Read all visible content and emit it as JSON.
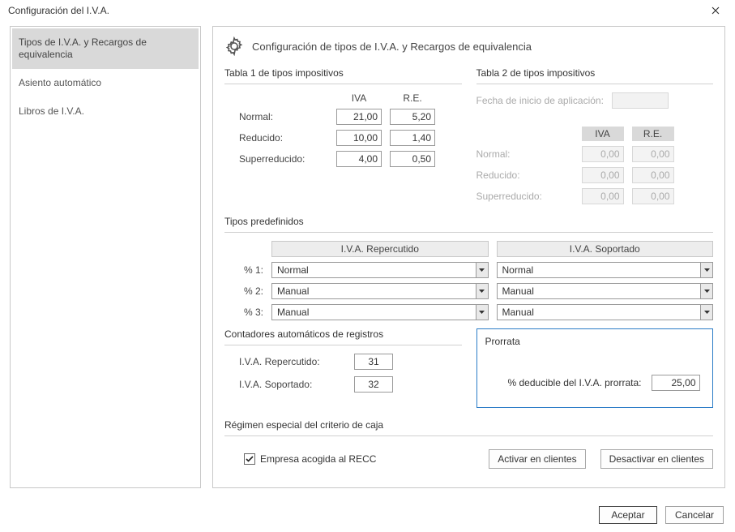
{
  "window": {
    "title": "Configuración del I.V.A."
  },
  "sidebar": {
    "items": [
      {
        "label": "Tipos de I.V.A. y Recargos de equivalencia"
      },
      {
        "label": "Asiento automático"
      },
      {
        "label": "Libros de I.V.A."
      }
    ]
  },
  "heading": "Configuración de tipos de I.V.A. y Recargos de equivalencia",
  "tabla1": {
    "title": "Tabla 1 de tipos impositivos",
    "col_iva": "IVA",
    "col_re": "R.E.",
    "rows": [
      {
        "label": "Normal:",
        "iva": "21,00",
        "re": "5,20"
      },
      {
        "label": "Reducido:",
        "iva": "10,00",
        "re": "1,40"
      },
      {
        "label": "Superreducido:",
        "iva": "4,00",
        "re": "0,50"
      }
    ]
  },
  "tabla2": {
    "title": "Tabla 2 de tipos impositivos",
    "fecha_label": "Fecha de inicio de aplicación:",
    "col_iva": "IVA",
    "col_re": "R.E.",
    "rows": [
      {
        "label": "Normal:",
        "iva": "0,00",
        "re": "0,00"
      },
      {
        "label": "Reducido:",
        "iva": "0,00",
        "re": "0,00"
      },
      {
        "label": "Superreducido:",
        "iva": "0,00",
        "re": "0,00"
      }
    ]
  },
  "predef": {
    "title": "Tipos predefinidos",
    "col_rep": "I.V.A. Repercutido",
    "col_sop": "I.V.A. Soportado",
    "rows": [
      {
        "label": "% 1:",
        "rep": "Normal",
        "sop": "Normal"
      },
      {
        "label": "% 2:",
        "rep": "Manual",
        "sop": "Manual"
      },
      {
        "label": "% 3:",
        "rep": "Manual",
        "sop": "Manual"
      }
    ]
  },
  "counters": {
    "title": "Contadores automáticos de registros",
    "rep_label": "I.V.A. Repercutido:",
    "rep_value": "31",
    "sop_label": "I.V.A. Soportado:",
    "sop_value": "32"
  },
  "prorrata": {
    "title": "Prorrata",
    "label": "% deducible del I.V.A. prorrata:",
    "value": "25,00"
  },
  "recc": {
    "title": "Régimen especial del criterio de caja",
    "check_label": "Empresa acogida al RECC",
    "activate": "Activar en clientes",
    "deactivate": "Desactivar en clientes"
  },
  "footer": {
    "ok": "Aceptar",
    "cancel": "Cancelar"
  }
}
